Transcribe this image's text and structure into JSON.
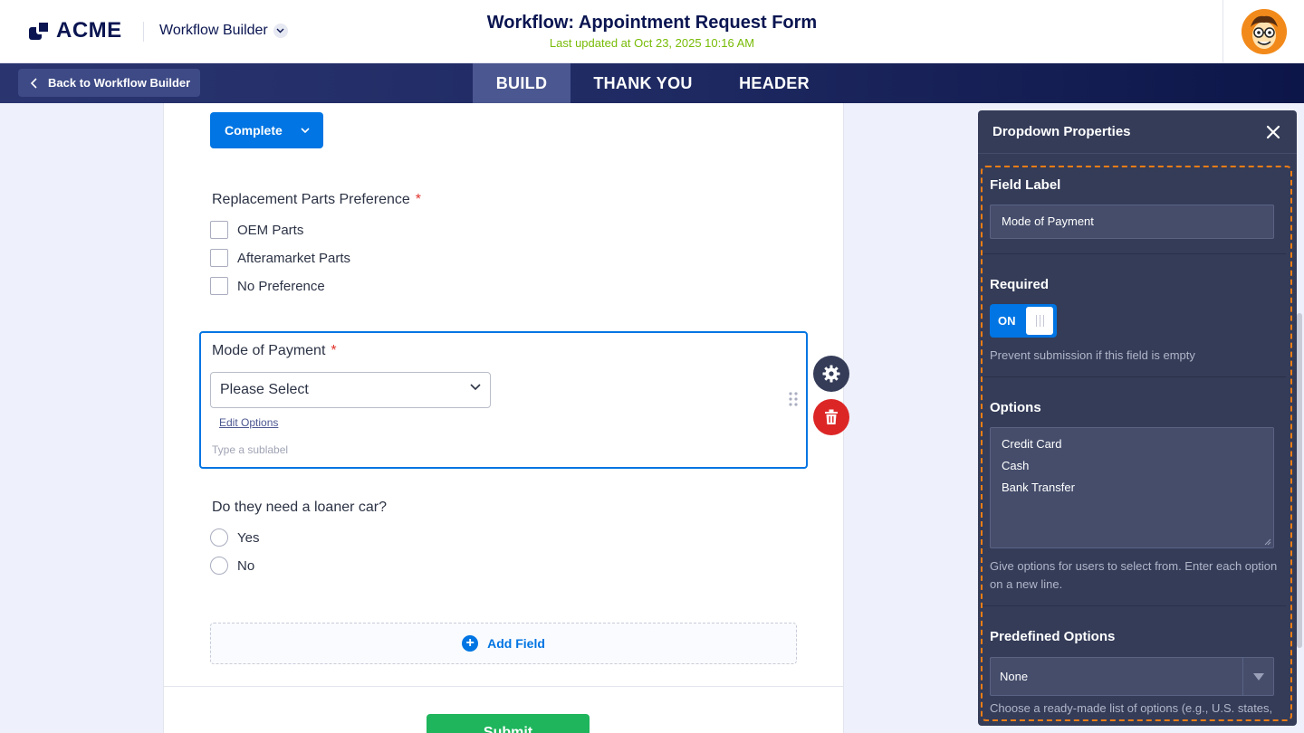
{
  "brand": {
    "logo_text": "ACME"
  },
  "header": {
    "app_switcher": "Workflow Builder",
    "title": "Workflow: Appointment Request Form",
    "subtitle": "Last updated at Oct 23, 2025 10:16 AM"
  },
  "nav": {
    "back_label": "Back to Workflow Builder",
    "tabs": [
      {
        "label": "BUILD",
        "active": true
      },
      {
        "label": "THANK YOU",
        "active": false
      },
      {
        "label": "HEADER",
        "active": false
      }
    ]
  },
  "form": {
    "status_button": "Complete",
    "parts": {
      "label": "Replacement Parts Preference",
      "required_mark": "*",
      "options": [
        "OEM Parts",
        "Afteramarket Parts",
        "No Preference"
      ]
    },
    "payment": {
      "label": "Mode of Payment",
      "required_mark": "*",
      "select_value": "Please Select",
      "edit_options": "Edit Options",
      "sublabel_placeholder": "Type a sublabel"
    },
    "loaner": {
      "label": "Do they need a loaner car?",
      "options": [
        "Yes",
        "No"
      ]
    },
    "add_field": "Add Field",
    "submit": "Submit"
  },
  "panel": {
    "title": "Dropdown Properties",
    "field_label": {
      "heading": "Field Label",
      "value": "Mode of Payment"
    },
    "required": {
      "heading": "Required",
      "toggle_label": "ON",
      "enabled": true,
      "help": "Prevent submission if this field is empty"
    },
    "options": {
      "heading": "Options",
      "lines": [
        "Credit Card",
        "Cash",
        "Bank Transfer"
      ],
      "help": "Give options for users to select from. Enter each option on a new line."
    },
    "predefined": {
      "heading": "Predefined Options",
      "value": "None",
      "help": "Choose a ready-made list of options (e.g., U.S. states, days, months, etc.)"
    }
  },
  "colors": {
    "brand_navy": "#0a1551",
    "primary_blue": "#0075e3",
    "panel_bg": "#343c58",
    "highlight_orange": "#f07d15",
    "submit_green": "#1fb55c",
    "danger_red": "#dc2626",
    "updated_green": "#78bb07"
  }
}
